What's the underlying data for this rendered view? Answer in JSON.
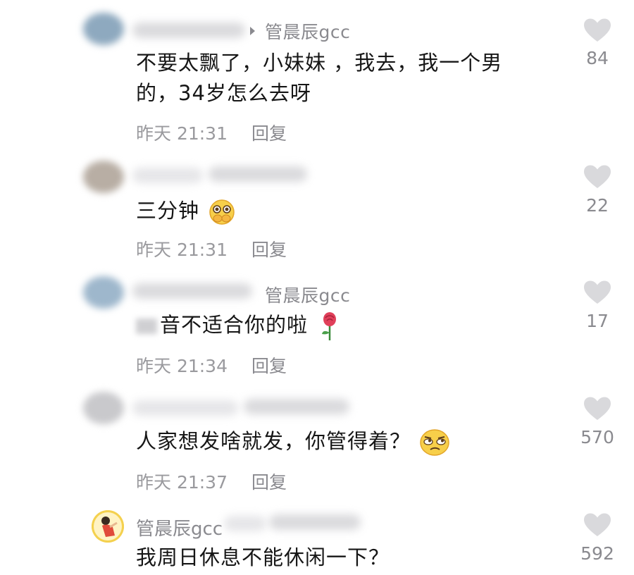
{
  "comments": [
    {
      "reply_to": "管晨辰gcc",
      "text": "不要太飘了，小妹妹 ，我去，我一个男的，34岁怎么去呀",
      "time": "昨天 21:31",
      "reply_label": "回复",
      "likes": "84"
    },
    {
      "text": "三分钟",
      "emoji": "pleading-hands-emoji",
      "time": "昨天 21:31",
      "reply_label": "回复",
      "likes": "22"
    },
    {
      "reply_to": "管晨辰gcc",
      "text": "音不适合你的啦",
      "emoji": "rose-emoji",
      "time": "昨天 21:34",
      "reply_label": "回复",
      "likes": "17"
    },
    {
      "text": "人家想发啥就发，你管得着？",
      "emoji": "eye-roll-emoji",
      "time": "昨天 21:37",
      "reply_label": "回复",
      "likes": "570"
    },
    {
      "author": "管晨辰gcc",
      "text": "我周日休息不能休闲一下？",
      "likes": "592"
    }
  ],
  "icons": {
    "like": "heart-icon",
    "reply_arrow": "triangle-right-icon"
  },
  "colors": {
    "meta_gray": "#8a8a8f",
    "heart_gray": "#d9d9dc",
    "text": "#161616"
  }
}
